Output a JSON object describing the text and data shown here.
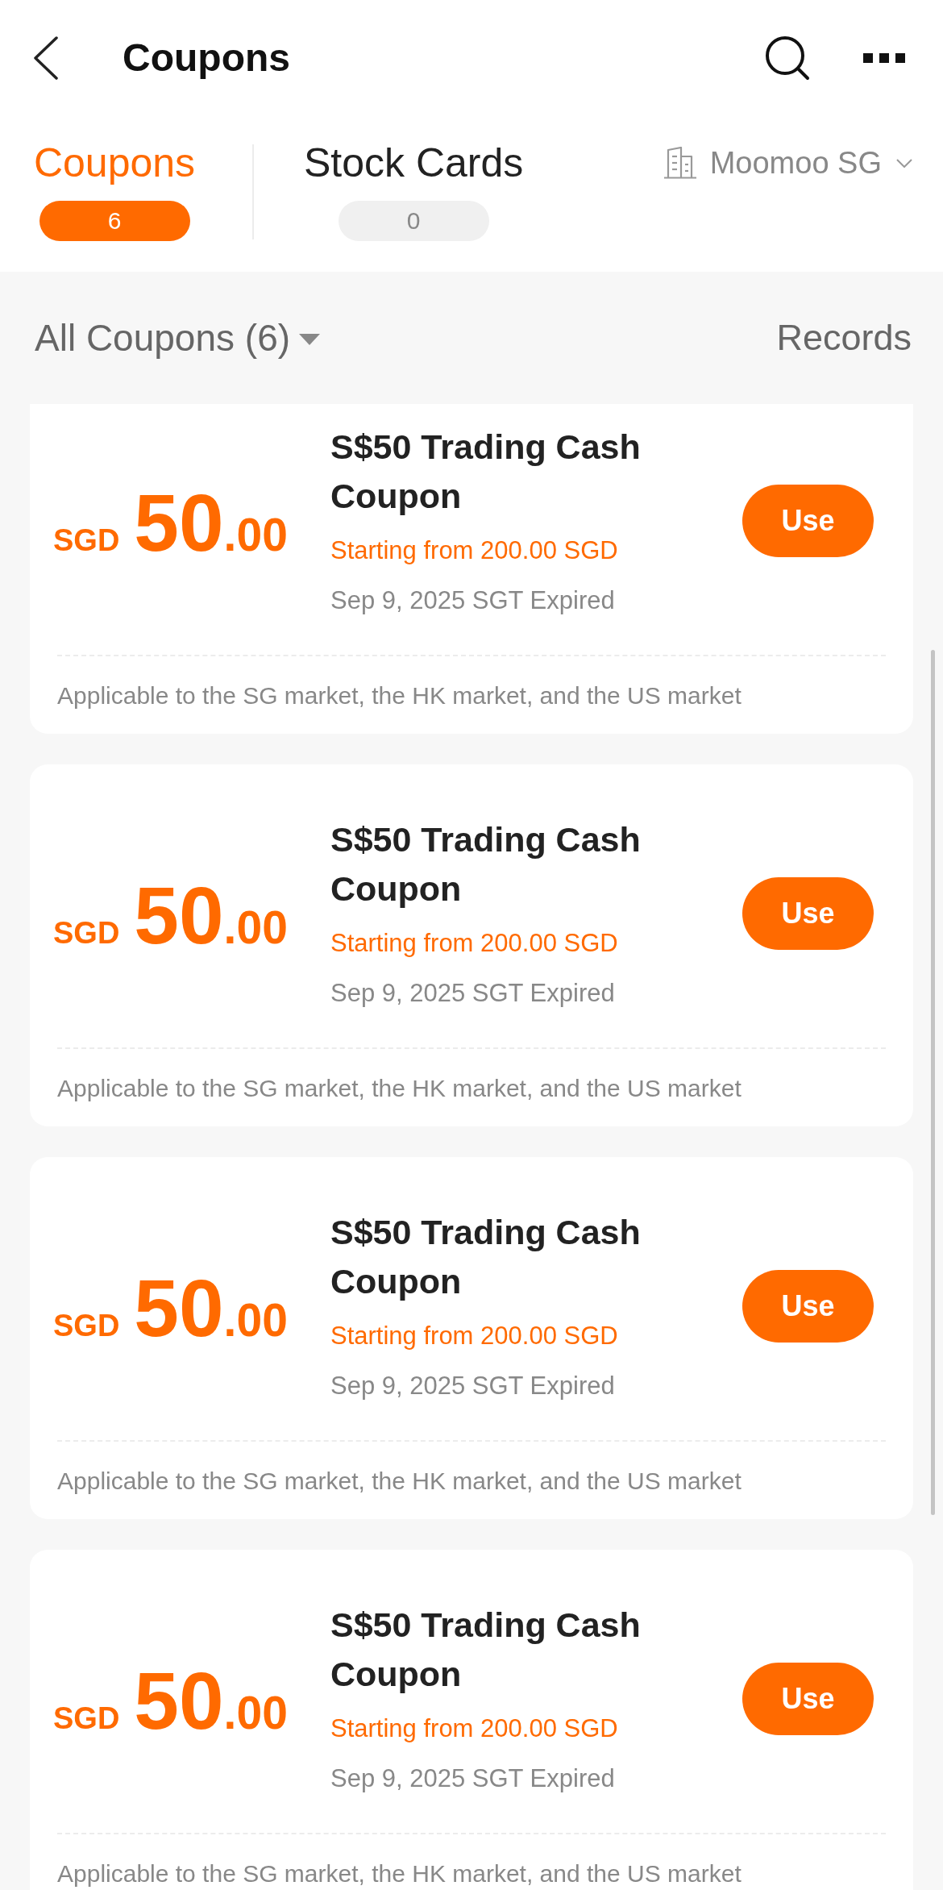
{
  "header": {
    "title": "Coupons"
  },
  "tabs": [
    {
      "label": "Coupons",
      "count": "6",
      "selected": true
    },
    {
      "label": "Stock Cards",
      "count": "0",
      "selected": false
    }
  ],
  "account": {
    "label": "Moomoo SG"
  },
  "filter": {
    "label": "All Coupons (6)",
    "records": "Records"
  },
  "coupons": [
    {
      "currency": "SGD",
      "amount_whole": "50",
      "amount_decimal": ".00",
      "title": "S$50 Trading Cash Coupon",
      "threshold": "Starting from 200.00 SGD",
      "expiry": "Sep 9, 2025 SGT Expired",
      "action": "Use",
      "scope": "Applicable to the SG market, the HK market, and the US market"
    },
    {
      "currency": "SGD",
      "amount_whole": "50",
      "amount_decimal": ".00",
      "title": "S$50 Trading Cash Coupon",
      "threshold": "Starting from 200.00 SGD",
      "expiry": "Sep 9, 2025 SGT Expired",
      "action": "Use",
      "scope": "Applicable to the SG market, the HK market, and the US market"
    },
    {
      "currency": "SGD",
      "amount_whole": "50",
      "amount_decimal": ".00",
      "title": "S$50 Trading Cash Coupon",
      "threshold": "Starting from 200.00 SGD",
      "expiry": "Sep 9, 2025 SGT Expired",
      "action": "Use",
      "scope": "Applicable to the SG market, the HK market, and the US market"
    },
    {
      "currency": "SGD",
      "amount_whole": "50",
      "amount_decimal": ".00",
      "title": "S$50 Trading Cash Coupon",
      "threshold": "Starting from 200.00 SGD",
      "expiry": "Sep 9, 2025 SGT Expired",
      "action": "Use",
      "scope": "Applicable to the SG market, the HK market, and the US market"
    }
  ]
}
